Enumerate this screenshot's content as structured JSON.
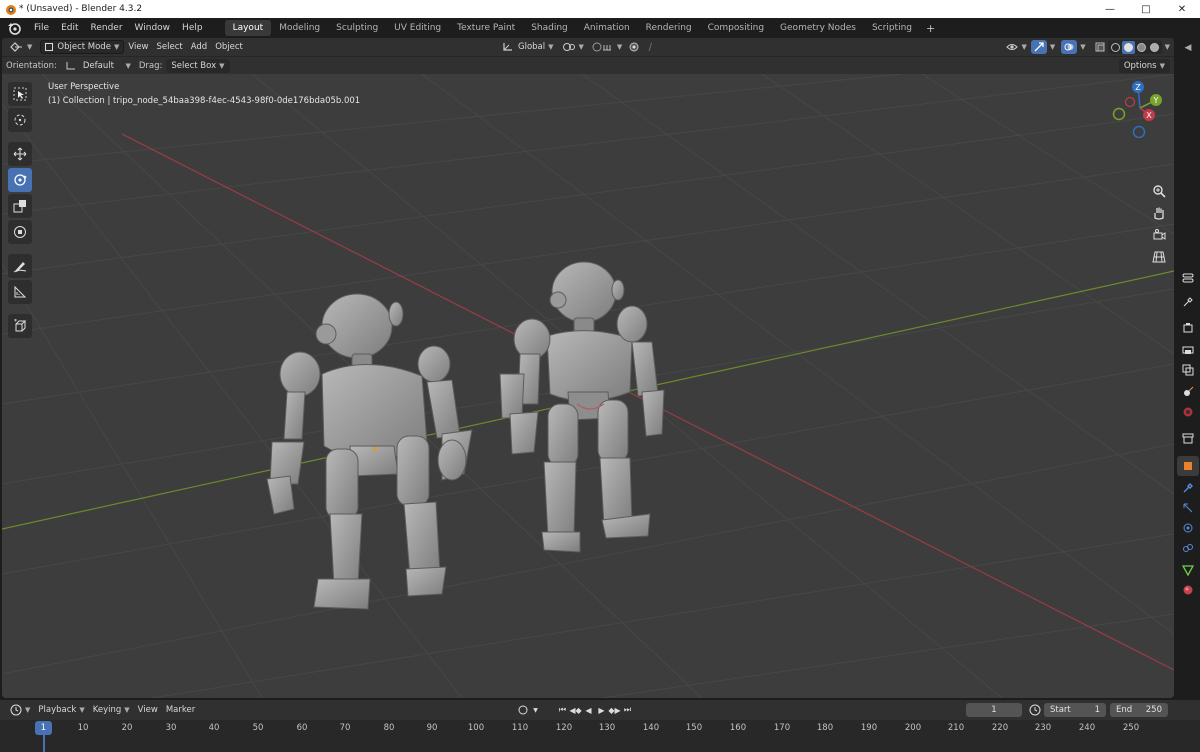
{
  "window": {
    "title": "* (Unsaved) - Blender 4.3.2",
    "controls": [
      "minimize-icon",
      "maximize-icon",
      "close-icon"
    ]
  },
  "menubar": {
    "items": [
      "File",
      "Edit",
      "Render",
      "Window",
      "Help"
    ],
    "workspaces": [
      "Layout",
      "Modeling",
      "Sculpting",
      "UV Editing",
      "Texture Paint",
      "Shading",
      "Animation",
      "Rendering",
      "Compositing",
      "Geometry Nodes",
      "Scripting"
    ],
    "active_workspace": "Layout",
    "add_tab": "+"
  },
  "viewport_header": {
    "mode": "Object Mode",
    "menus": [
      "View",
      "Select",
      "Add",
      "Object"
    ],
    "transform_orientation": "Global",
    "snap_icon": "snap-increment-icon",
    "proportional_icon": "proportional-edit-icon"
  },
  "tool_settings": {
    "orientation_label": "Orientation:",
    "orientation_value": "Default",
    "drag_label": "Drag:",
    "drag_value": "Select Box",
    "options_label": "Options"
  },
  "viewport": {
    "perspective_label": "User Perspective",
    "collection_label": "(1) Collection | tripo_node_54baa398-f4ec-4543-98f0-0de176bda05b.001",
    "active_tool": "rotate",
    "gizmo_axes": [
      "Z",
      "Y",
      "X"
    ]
  },
  "toolbar": {
    "tools": [
      "select-box",
      "cursor",
      "move",
      "rotate",
      "scale",
      "transform",
      "annotate",
      "measure",
      "add-cube"
    ]
  },
  "timeline": {
    "menus": [
      "Playback",
      "Keying",
      "View",
      "Marker"
    ],
    "current_frame": "1",
    "start_label": "Start",
    "start_value": "1",
    "end_label": "End",
    "end_value": "250",
    "ruler_labels": [
      "1",
      "10",
      "20",
      "30",
      "40",
      "50",
      "60",
      "70",
      "80",
      "90",
      "100",
      "110",
      "120",
      "130",
      "140",
      "150",
      "160",
      "170",
      "180",
      "190",
      "200",
      "210",
      "220",
      "230",
      "240",
      "250"
    ],
    "current_marker": "1"
  },
  "colors": {
    "accent": "#4772b3",
    "x_axis": "#9b3c46",
    "y_axis": "#6c8a2a",
    "background": "#3d3d3d"
  }
}
